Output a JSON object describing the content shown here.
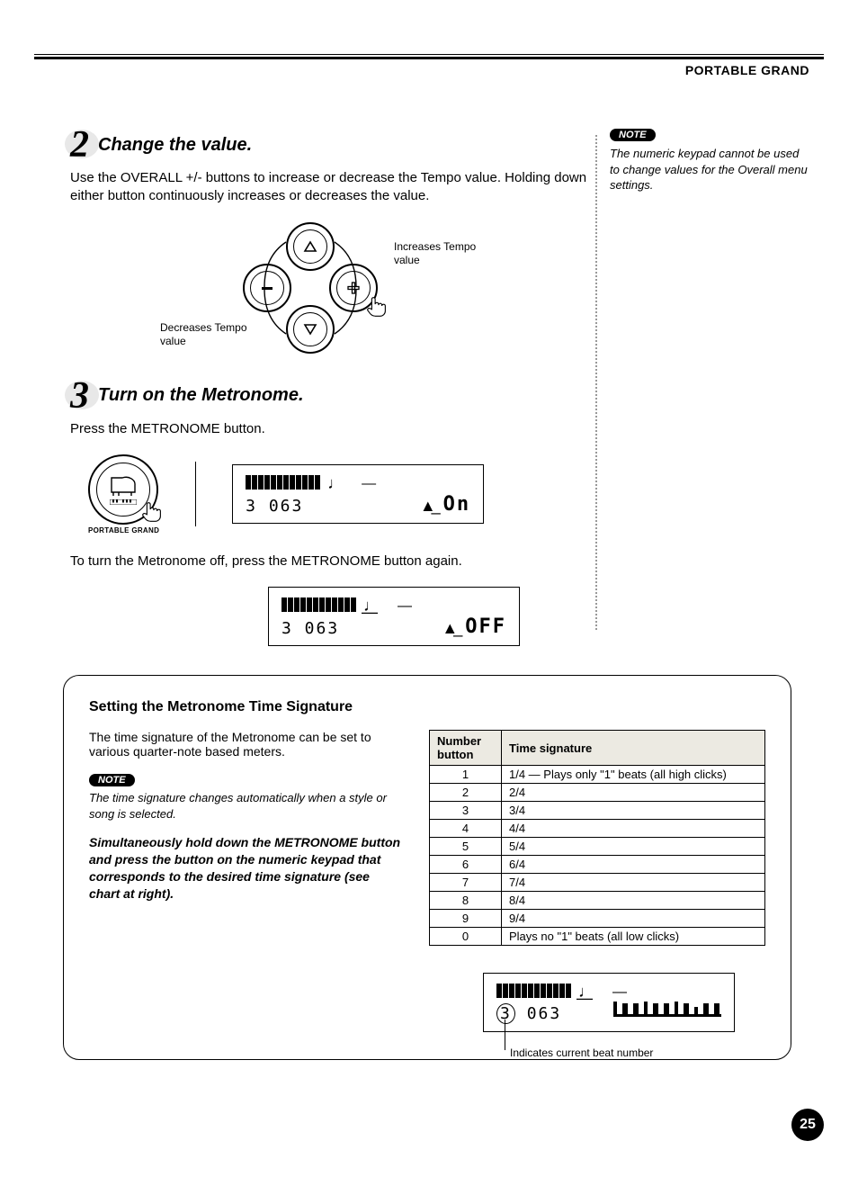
{
  "header": {
    "section": "PORTABLE GRAND"
  },
  "step2": {
    "num": "2",
    "title": "Change the value.",
    "body": "Use the OVERALL +/- buttons to increase or decrease the Tempo value. Holding down either button continuously increases or decreases the value.",
    "inc_label": "Increases Tempo value",
    "dec_label": "Decreases Tempo value"
  },
  "side_note": {
    "pill": "NOTE",
    "text": "The numeric keypad cannot be used to change values for the Overall menu settings."
  },
  "step3": {
    "num": "3",
    "title": "Turn on the Metronome.",
    "body": "Press the METRONOME button.",
    "button_label": "PORTABLE GRAND",
    "offline": "To turn the Metronome off, press the METRONOME button again."
  },
  "lcd1": {
    "num": "3 063",
    "text": "On"
  },
  "lcd2": {
    "num": "3 063",
    "text": "OFF"
  },
  "panel": {
    "title": "Setting the Metronome Time Signature",
    "intro": "The time signature of the Metronome can be set to various quarter-note based meters.",
    "note_pill": "NOTE",
    "note_text": "The time signature changes automatically when a style or song is selected.",
    "instruction": "Simultaneously hold down the METRONOME button and press the button on the numeric keypad that corresponds to the desired time signature (see chart at right).",
    "table": {
      "h1": "Number button",
      "h2": "Time signature",
      "rows": [
        {
          "n": "1",
          "t": "1/4 — Plays only \"1\" beats (all high clicks)"
        },
        {
          "n": "2",
          "t": "2/4"
        },
        {
          "n": "3",
          "t": "3/4"
        },
        {
          "n": "4",
          "t": "4/4"
        },
        {
          "n": "5",
          "t": "5/4"
        },
        {
          "n": "6",
          "t": "6/4"
        },
        {
          "n": "7",
          "t": "7/4"
        },
        {
          "n": "8",
          "t": "8/4"
        },
        {
          "n": "9",
          "t": "9/4"
        },
        {
          "n": "0",
          "t": "Plays no \"1\" beats (all low clicks)"
        }
      ]
    },
    "lcd3": {
      "num_prefix": "3",
      "num_rest": "063",
      "caption": "Indicates current beat number"
    }
  },
  "page_number": "25"
}
